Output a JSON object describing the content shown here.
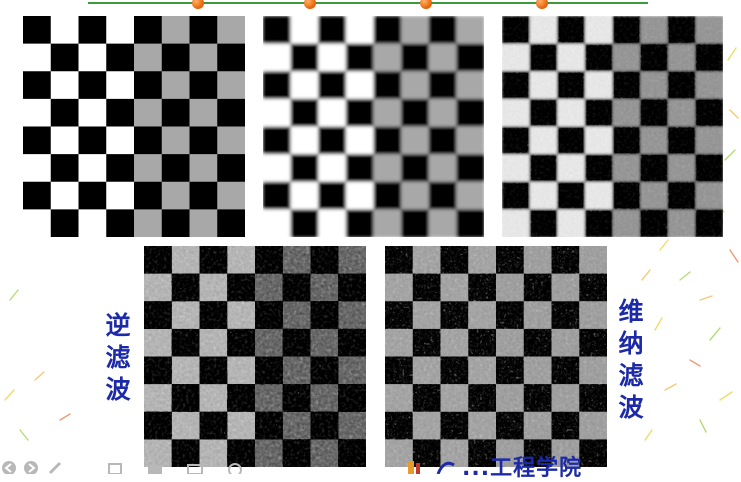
{
  "slide": {
    "top_row": [
      {
        "name": "original",
        "noise": "none",
        "blur": 0
      },
      {
        "name": "blurred",
        "noise": "none",
        "blur": 1.6
      },
      {
        "name": "blurred-noisy",
        "noise": "light",
        "blur": 1.2
      }
    ],
    "bottom_row": [
      {
        "name": "inverse-filter-result",
        "noise": "heavy",
        "blur": 0
      },
      {
        "name": "wiener-filter-result",
        "noise": "medium",
        "blur": 0
      }
    ]
  },
  "labels": {
    "inverse": [
      "逆",
      "滤",
      "波"
    ],
    "wiener": [
      "维",
      "纳",
      "滤",
      "波"
    ]
  },
  "footer": {
    "institution": "...工程学院"
  },
  "colors": {
    "label_blue": "#1c2aa8",
    "line_green": "#3c9a3c",
    "dot_orange": "#e85c00"
  }
}
